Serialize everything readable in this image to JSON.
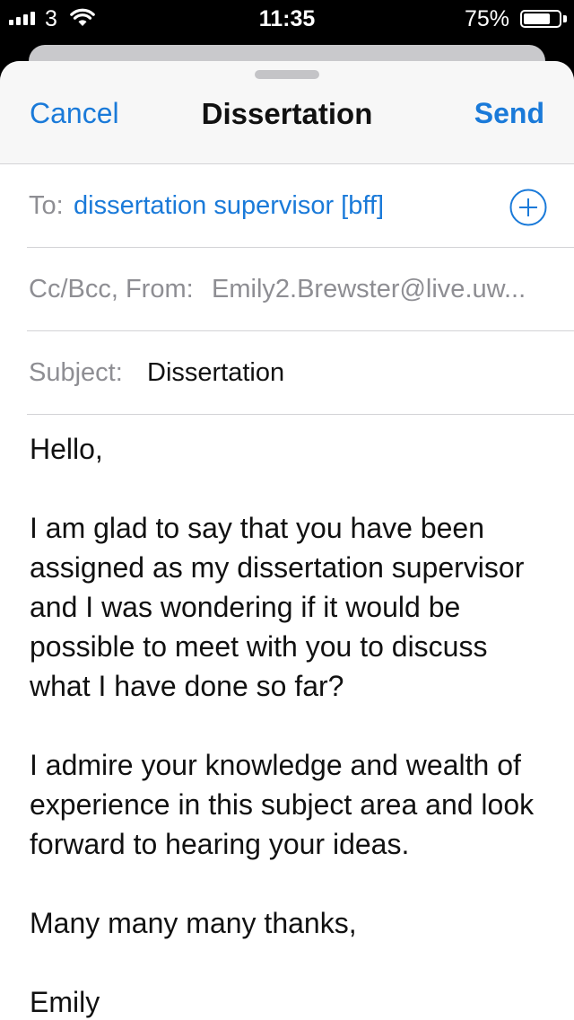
{
  "status_bar": {
    "carrier": "3",
    "time": "11:35",
    "battery_percent": "75%",
    "battery_level": 0.75,
    "icons": [
      "signal-bars-icon",
      "wifi-icon",
      "battery-icon"
    ]
  },
  "nav": {
    "cancel_label": "Cancel",
    "title": "Dissertation",
    "send_label": "Send"
  },
  "to_field": {
    "label": "To:",
    "value": "dissertation supervisor [bff]",
    "add_icon": "plus-circle-icon"
  },
  "cc_field": {
    "label": "Cc/Bcc, From:",
    "value": "Emily2.Brewster@live.uw..."
  },
  "subject_field": {
    "label": "Subject:",
    "value": "Dissertation"
  },
  "body": {
    "greeting": "Hello,",
    "paragraph1": "I am glad to say that you have been assigned as my dissertation supervisor and I was wondering if it would be possible to meet with you to discuss what I have done so far?",
    "paragraph2": "I admire your knowledge and wealth of experience in this subject area and look forward to hearing your ideas.",
    "closing": "Many many many thanks,",
    "signature": "Emily"
  },
  "colors": {
    "accent": "#1a7ad9",
    "secondary_text": "#8e8e93",
    "separator": "#d3d3d6"
  }
}
